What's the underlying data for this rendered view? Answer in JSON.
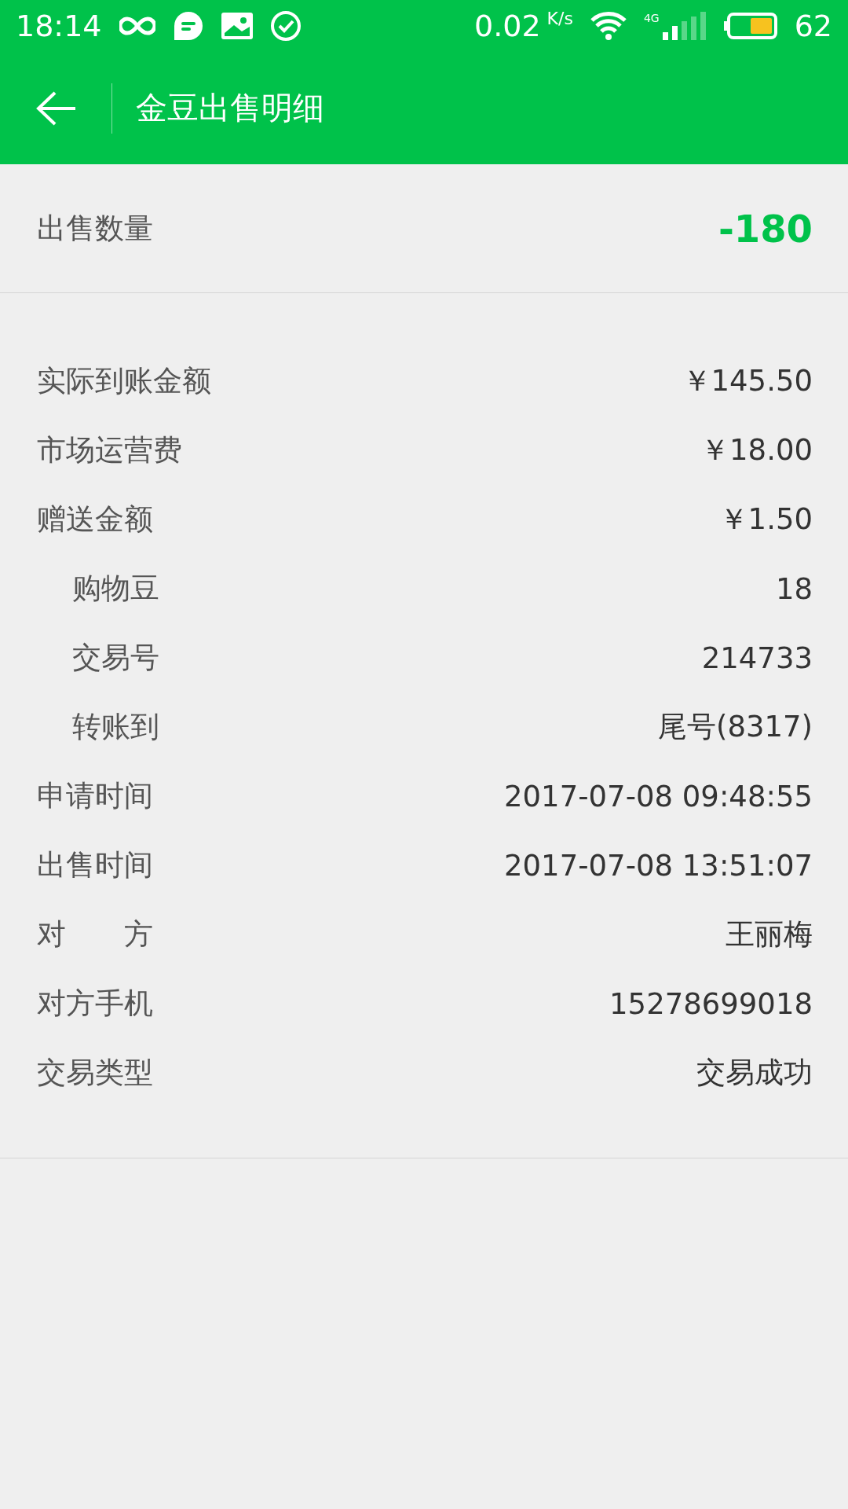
{
  "status_bar": {
    "time": "18:14",
    "speed": "0.02",
    "speed_unit": "K/s",
    "network": "4G",
    "battery": "62"
  },
  "app_bar": {
    "title": "金豆出售明细"
  },
  "summary": {
    "label": "出售数量",
    "value": "-180"
  },
  "details": [
    {
      "kind": "main",
      "label": "实际到账金额",
      "value": "￥145.50"
    },
    {
      "kind": "main",
      "label": "市场运营费",
      "value": "￥18.00"
    },
    {
      "kind": "main",
      "label": "赠送金额",
      "value": "￥1.50"
    },
    {
      "kind": "sub",
      "label": "购物豆",
      "value": "18"
    },
    {
      "kind": "sub",
      "label": "交易号",
      "value": "214733"
    },
    {
      "kind": "sub",
      "label": "转账到",
      "value": "尾号(8317)"
    },
    {
      "kind": "main",
      "label": "申请时间",
      "value": "2017-07-08 09:48:55"
    },
    {
      "kind": "main",
      "label": "出售时间",
      "value": "2017-07-08 13:51:07"
    },
    {
      "kind": "main",
      "label": "对　　方",
      "value": "王丽梅"
    },
    {
      "kind": "main",
      "label": "对方手机",
      "value": "15278699018"
    },
    {
      "kind": "main",
      "label": "交易类型",
      "value": "交易成功"
    }
  ]
}
